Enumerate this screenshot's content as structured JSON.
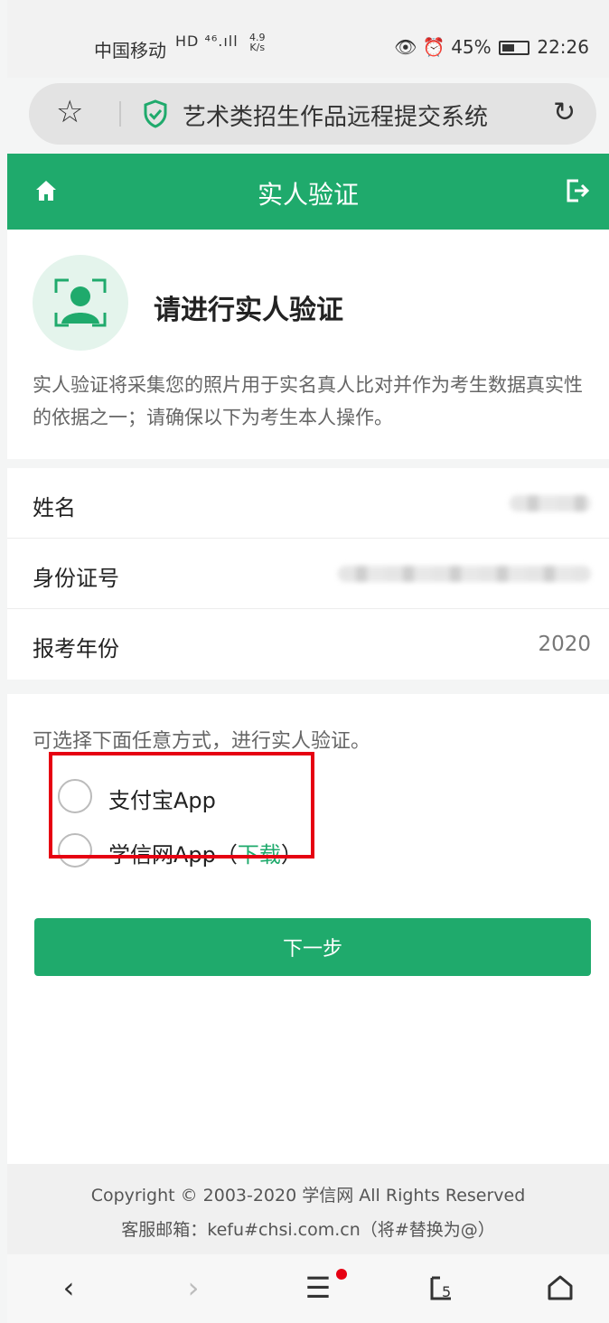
{
  "status_bar": {
    "carrier": "中国移动",
    "signal": "HD ⁴⁶.ıll",
    "net_speed_value": "4.9",
    "net_speed_unit": "K/s",
    "battery": "45%",
    "time": "22:26"
  },
  "browser": {
    "address_title": "艺术类招生作品远程提交系统"
  },
  "header": {
    "title": "实人验证"
  },
  "intro": {
    "heading": "请进行实人验证",
    "description": "实人验证将采集您的照片用于实名真人比对并作为考生数据真实性的依据之一；请确保以下为考生本人操作。"
  },
  "info": {
    "rows": [
      {
        "label": "姓名",
        "value": ""
      },
      {
        "label": "身份证号",
        "value": ""
      },
      {
        "label": "报考年份",
        "value": "2020"
      }
    ]
  },
  "verify": {
    "hint": "可选择下面任意方式，进行实人验证。",
    "options": [
      {
        "label": "支付宝App",
        "selected": false
      },
      {
        "label": "学信网App（",
        "link": "下载",
        "suffix": "）",
        "selected": false
      }
    ],
    "next_label": "下一步"
  },
  "footer": {
    "copyright": "Copyright © 2003-2020 学信网 All Rights Reserved",
    "email": "客服邮箱：kefu#chsi.com.cn（将#替换为@）"
  },
  "bottom_nav": {
    "tabs_count": "5"
  },
  "colors": {
    "brand_green": "#1faa6c",
    "highlight_red": "#e60012"
  }
}
